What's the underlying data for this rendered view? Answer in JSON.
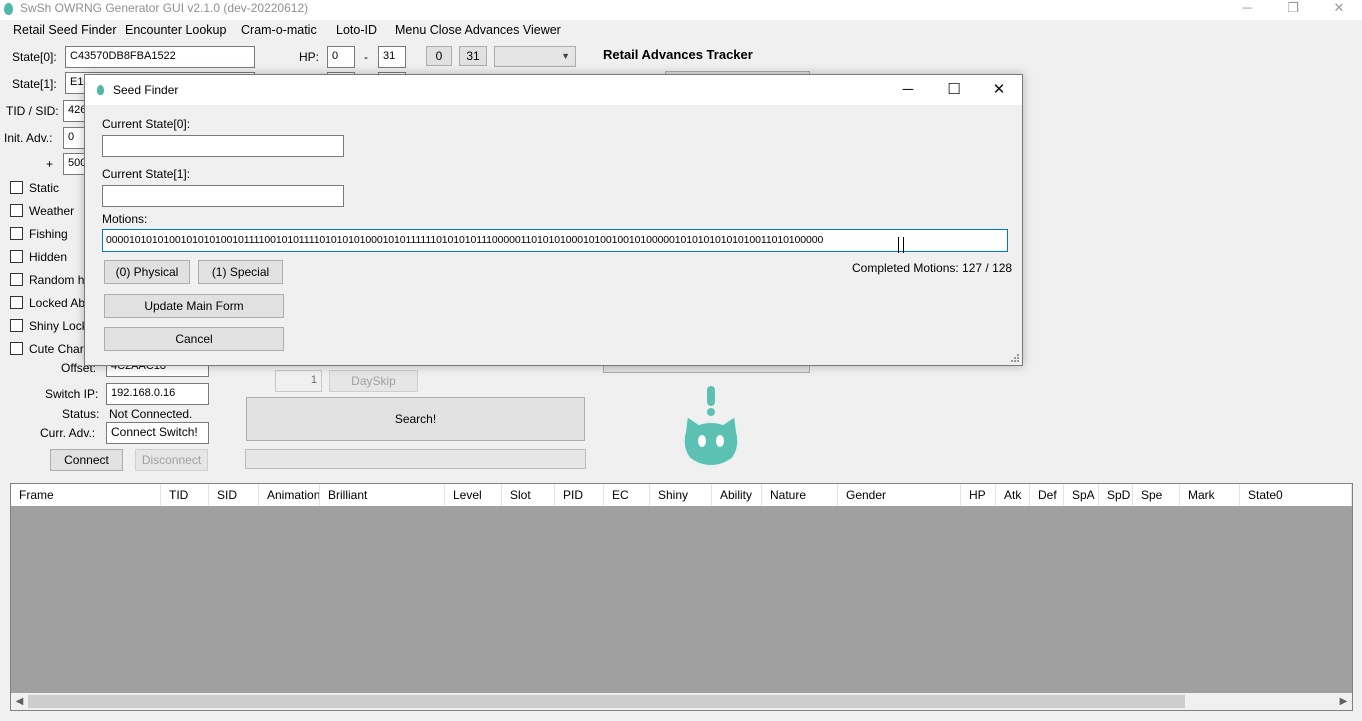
{
  "window": {
    "title": "SwSh OWRNG Generator GUI v2.1.0 (dev-20220612)",
    "minimize": "─",
    "maximize": "❐",
    "close": "✕"
  },
  "menu": [
    "Retail Seed Finder",
    "Encounter Lookup",
    "Cram-o-matic",
    "Loto-ID",
    "Menu Close Advances Viewer"
  ],
  "main": {
    "state0_label": "State[0]:",
    "state0_value": "C43570DB8FBA1522",
    "state1_label": "State[1]:",
    "state1_value": "E17",
    "tidsid_label": "TID / SID:",
    "tidsid_value": "426",
    "init_adv_label": "Init. Adv.:",
    "init_adv_value": "0",
    "plus_label": "+",
    "plus_value": "500",
    "hp_label": "HP:",
    "hp_min": "0",
    "hp_dash": "-",
    "hp_max": "31",
    "hp_btn_min": "0",
    "hp_btn_max": "31",
    "retail_tracker_label": "Retail Advances Tracker",
    "checkboxes": [
      "Static",
      "Weather",
      "Fishing",
      "Hidden",
      "Random h",
      "Locked Ab",
      "Shiny Lock",
      "Cute Char"
    ],
    "offset_label": "Offset:",
    "offset_value": "4C2AAC18",
    "switch_ip_label": "Switch IP:",
    "switch_ip_value": "192.168.0.16",
    "status_label": "Status:",
    "status_value": "Not Connected.",
    "curr_adv_label": "Curr. Adv.:",
    "curr_adv_value": "Connect Switch!",
    "connect_button": "Connect",
    "disconnect_button": "Disconnect",
    "dayskip_value": "1",
    "dayskip_button": "DaySkip",
    "search_button": "Search!"
  },
  "table": {
    "columns": [
      "Frame",
      "TID",
      "SID",
      "Animation",
      "Brilliant",
      "Level",
      "Slot",
      "PID",
      "EC",
      "Shiny",
      "Ability",
      "Nature",
      "Gender",
      "HP",
      "Atk",
      "Def",
      "SpA",
      "SpD",
      "Spe",
      "Mark",
      "State0"
    ],
    "scroll_left": "◀",
    "scroll_right": "▶"
  },
  "dialog": {
    "title": "Seed Finder",
    "minimize": "─",
    "maximize": "☐",
    "close": "✕",
    "state0_label": "Current State[0]:",
    "state0_value": "",
    "state1_label": "Current State[1]:",
    "state1_value": "",
    "motions_label": "Motions:",
    "motions_value": "0000101010100101010100101111001010111101010101000101011111101010101110000011010101000101001001010000010101010101010011010100000",
    "completed_motions": "Completed Motions: 127 / 128",
    "physical_button": "(0) Physical",
    "special_button": "(1) Special",
    "update_button": "Update Main Form",
    "cancel_button": "Cancel"
  },
  "colors": {
    "accent": "#0078d7",
    "mascot": "#5cc1b3",
    "grid_bg": "#a0a0a0"
  }
}
